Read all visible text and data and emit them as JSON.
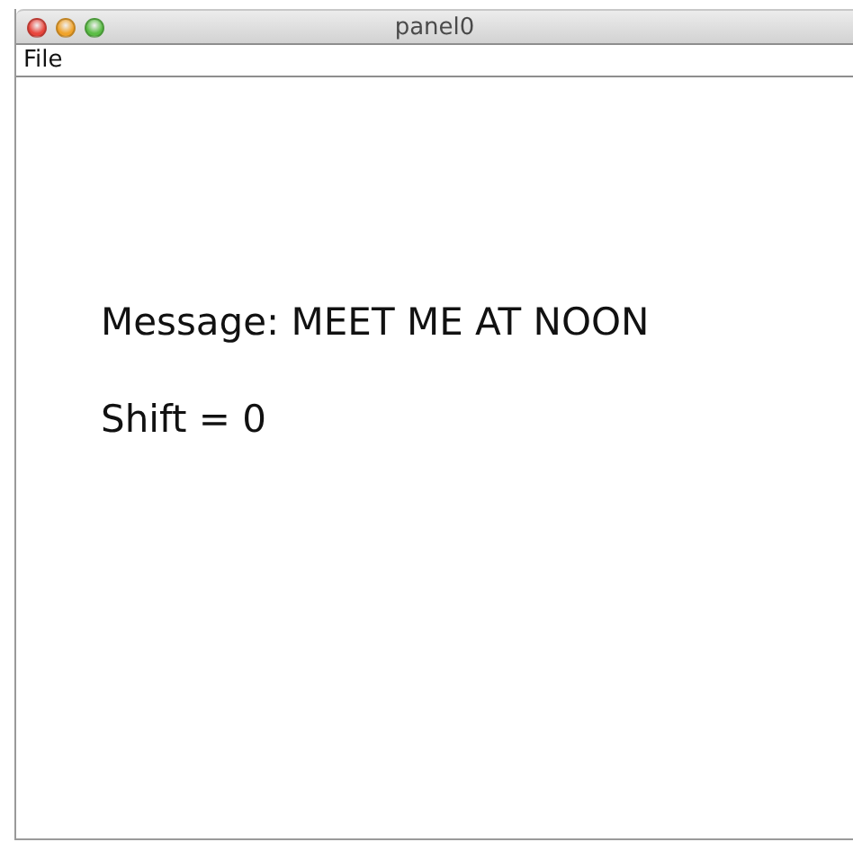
{
  "window": {
    "title": "panel0",
    "controls": [
      {
        "kind": "close"
      },
      {
        "kind": "minimize"
      },
      {
        "kind": "zoom"
      }
    ]
  },
  "menu_bar": [
    "File"
  ],
  "content": {
    "message": "Message: MEET ME AT NOON",
    "shift": "Shift = 0"
  }
}
